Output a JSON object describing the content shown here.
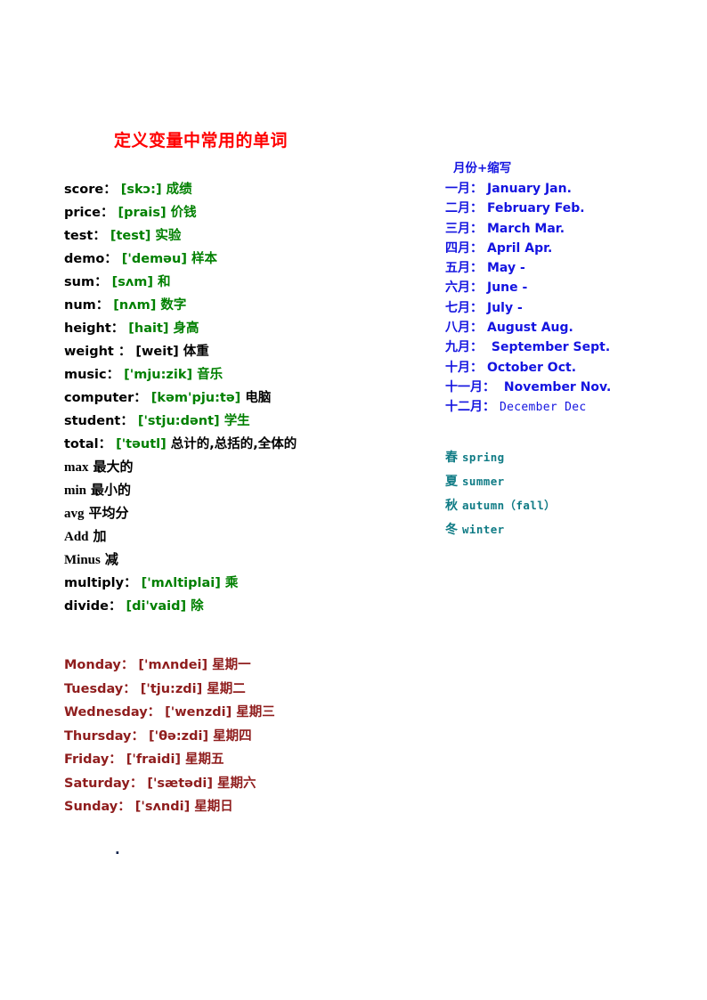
{
  "document": {
    "title": "定义变量中常用的单词",
    "title_color": "#ff0000",
    "stray_mark": "."
  },
  "colors": {
    "word_black": "#000000",
    "ipa_green": "#008000",
    "weekday_red": "#8f1d1d",
    "month_blue": "#1414e0",
    "season_teal": "#0f7b85",
    "title_red": "#ff0000"
  },
  "vocabulary": {
    "items": [
      {
        "word": "score",
        "colon": "：",
        "ipa": "[skɔ:]",
        "space": "",
        "cn": "成绩",
        "style": "default"
      },
      {
        "word": "price",
        "colon": "：",
        "ipa": "[prais]",
        "space": "",
        "cn": "价钱",
        "style": "default"
      },
      {
        "word": "test",
        "colon": "：",
        "ipa": "[test]",
        "space": "",
        "cn": "实验",
        "style": "default"
      },
      {
        "word": "demo",
        "colon": "：",
        "ipa": "['deməu]",
        "space": "",
        "cn": "样本",
        "style": "default"
      },
      {
        "word": "sum",
        "colon": "：",
        "ipa": "[sʌm]",
        "space": " ",
        "cn": "和",
        "style": "default"
      },
      {
        "word": "num",
        "colon": "：",
        "ipa": "[nʌm]",
        "space": " ",
        "cn": "数字",
        "style": "default"
      },
      {
        "word": "height",
        "colon": "：",
        "ipa": "[hait]",
        "space": " ",
        "cn": "身高",
        "style": "default"
      },
      {
        "word": "weight",
        "colon": " ：",
        "ipa": "[weit]",
        "space": " ",
        "cn": "体重",
        "style": "all-black"
      },
      {
        "word": "music",
        "colon": "：",
        "ipa": "['mju:zik]",
        "space": " ",
        "cn": "音乐",
        "style": "default"
      },
      {
        "word": "computer",
        "colon": "：",
        "ipa": "[kəm'pju:tə]",
        "space": " ",
        "cn": "电脑",
        "style": "cn-black"
      },
      {
        "word": "student",
        "colon": "：",
        "ipa": "['stju:dənt]",
        "space": " ",
        "cn": "学生",
        "style": "default"
      },
      {
        "word": "total",
        "colon": "：",
        "ipa": "['təutl]",
        "space": " ",
        "cn": "总计的,总括的,全体的",
        "style": "cn-black"
      },
      {
        "word": "max",
        "colon": "",
        "ipa": "",
        "space": " ",
        "cn": "最大的",
        "style": "serif"
      },
      {
        "word": "min",
        "colon": "",
        "ipa": "",
        "space": " ",
        "cn": "最小的",
        "style": "serif"
      },
      {
        "word": "avg",
        "colon": "",
        "ipa": "",
        "space": " ",
        "cn": "平均分",
        "style": "serif"
      },
      {
        "word": "Add",
        "colon": "",
        "ipa": "",
        "space": " ",
        "cn": "加",
        "style": "serif"
      },
      {
        "word": "Minus",
        "colon": "",
        "ipa": "",
        "space": " ",
        "cn": "减",
        "style": "serif"
      },
      {
        "word": "multiply",
        "colon": "：",
        "ipa": "['mʌltiplai]",
        "space": " ",
        "cn": "乘",
        "style": "default"
      },
      {
        "word": "divide",
        "colon": "：",
        "ipa": "[di'vaid]",
        "space": " ",
        "cn": "除",
        "style": "default"
      }
    ]
  },
  "weekdays": {
    "items": [
      {
        "word": "Monday",
        "colon": "：",
        "ipa": "['mʌndei]",
        "cn": "星期一"
      },
      {
        "word": "Tuesday",
        "colon": "：",
        "ipa": "['tju:zdi]",
        "cn": "星期二"
      },
      {
        "word": "Wednesday",
        "colon": "：",
        "ipa": "['wenzdi]",
        "cn": "星期三"
      },
      {
        "word": "Thursday",
        "colon": "：",
        "ipa": "['θə:zdi]",
        "cn": "星期四"
      },
      {
        "word": "Friday",
        "colon": "：",
        "ipa": "['fraidi]",
        "cn": "星期五"
      },
      {
        "word": "Saturday",
        "colon": "：",
        "ipa": "['sætədi]",
        "cn": "星期六"
      },
      {
        "word": "Sunday",
        "colon": "：",
        "ipa": "['sʌndi]",
        "cn": "星期日"
      }
    ]
  },
  "months": {
    "heading": "月份+缩写",
    "items": [
      {
        "cn": "一月：",
        "en": "January Jan.",
        "style": "default"
      },
      {
        "cn": "二月：",
        "en": "February Feb.",
        "style": "default"
      },
      {
        "cn": "三月：",
        "en": "March Mar.",
        "style": "default"
      },
      {
        "cn": "四月：",
        "en": "April Apr.",
        "style": "default"
      },
      {
        "cn": "五月：",
        "en": "May -",
        "style": "default"
      },
      {
        "cn": "六月：",
        "en": "June -",
        "style": "default"
      },
      {
        "cn": "七月：",
        "en": "July -",
        "style": "default"
      },
      {
        "cn": "八月：",
        "en": "August Aug.",
        "style": "default"
      },
      {
        "cn": "九月：",
        "en": " September Sept.",
        "style": "default"
      },
      {
        "cn": "十月：",
        "en": "October Oct.",
        "style": "default"
      },
      {
        "cn": "十一月：",
        "en": " November Nov.",
        "style": "default"
      },
      {
        "cn": "十二月：",
        "en": "December Dec",
        "style": "serif"
      }
    ]
  },
  "seasons": {
    "items": [
      {
        "cn": "春",
        "en": "spring"
      },
      {
        "cn": "夏",
        "en": "summer"
      },
      {
        "cn": "秋",
        "en": "autumn（fall）"
      },
      {
        "cn": "冬",
        "en": "winter"
      }
    ]
  }
}
